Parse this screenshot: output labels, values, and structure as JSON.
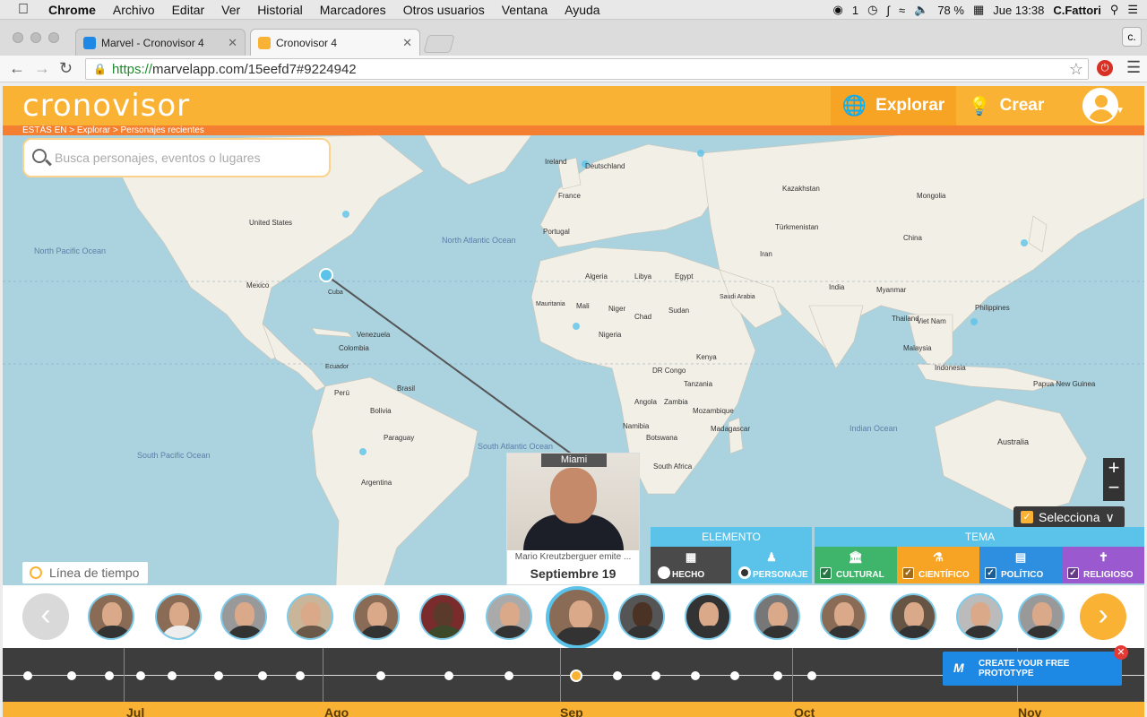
{
  "menubar": {
    "app_name": "Chrome",
    "items": [
      "Archivo",
      "Editar",
      "Ver",
      "Historial",
      "Marcadores",
      "Otros usuarios",
      "Ventana",
      "Ayuda"
    ],
    "battery": "78 %",
    "clock": "Jue 13:38",
    "user": "C.Fattori",
    "notif_count": "1"
  },
  "browser": {
    "tabs": [
      {
        "title": "Marvel - Cronovisor 4",
        "active": false
      },
      {
        "title": "Cronovisor 4",
        "active": true
      }
    ],
    "profile_label": "c.",
    "url_scheme": "https://",
    "url_rest": "marvelapp.com/15eefd7#9224942"
  },
  "app": {
    "logo": "cronovisor",
    "nav_explore": "Explorar",
    "nav_create": "Crear",
    "breadcrumb": "ESTÁS EN > Explorar > Personajes recientes",
    "search_placeholder": "Busca personajes, eventos o lugares",
    "zoom_in": "+",
    "zoom_out": "−",
    "selecciona_label": "Selecciona",
    "timeline_label": "Línea de tiempo"
  },
  "card": {
    "location": "Miami",
    "caption": "Mario Kreutzberguer emite ...",
    "date": "Septiembre 19"
  },
  "filters": {
    "elemento_header": "ELEMENTO",
    "tema_header": "TEMA",
    "items": [
      {
        "label": "HECHO",
        "color": "#4a4a4a",
        "state": "radio-off"
      },
      {
        "label": "PERSONAJE",
        "color": "#5bc3ea",
        "state": "radio-on"
      },
      {
        "label": "CULTURAL",
        "color": "#3eb56a",
        "state": "checked"
      },
      {
        "label": "CIENTÍFICO",
        "color": "#f7a425",
        "state": "checked"
      },
      {
        "label": "POLÍTICO",
        "color": "#2e8fe0",
        "state": "checked"
      },
      {
        "label": "RELIGIOSO",
        "color": "#9b59d0",
        "state": "checked"
      }
    ]
  },
  "timeline": {
    "months": [
      "Jul",
      "Ago",
      "Sep",
      "Oct",
      "Nov"
    ]
  },
  "promo": {
    "cta": "CREATE YOUR FREE PROTOTYPE"
  },
  "map_labels": {
    "north_pacific": "North Pacific Ocean",
    "north_atlantic": "North Atlantic Ocean",
    "south_atlantic": "South Atlantic Ocean",
    "south_pacific": "South Pacific Ocean",
    "indian": "Indian Ocean",
    "countries": [
      "United States",
      "Mexico",
      "Cuba",
      "Venezuela",
      "Colombia",
      "Brasil",
      "Perú",
      "Bolivia",
      "Paraguay",
      "Argentina",
      "Ecuador",
      "Niger",
      "Chad",
      "Sudan",
      "Nigeria",
      "Angola",
      "Namibia",
      "Botswana",
      "South Africa",
      "DR Congo",
      "Tanzania",
      "Kenya",
      "Madagascar",
      "Mozambique",
      "Zambia",
      "Egypt",
      "Libya",
      "Algeria",
      "Mali",
      "Mauritania",
      "Saudi Arabia",
      "Iran",
      "India",
      "China",
      "Mongolia",
      "Kazakhstan",
      "Türkmenistan",
      "Myanmar",
      "Thailand",
      "Viet Nam",
      "Malaysia",
      "Indonesia",
      "Australia",
      "Papua New Guinea",
      "Philippines",
      "Portugal",
      "France",
      "Deutschland",
      "Ireland"
    ]
  },
  "colors": {
    "brand_orange": "#f9b233",
    "brand_blue": "#5bc3ea",
    "breadcrumb_orange": "#f57f31",
    "ocean": "#aad3df",
    "land": "#f2efe6"
  }
}
